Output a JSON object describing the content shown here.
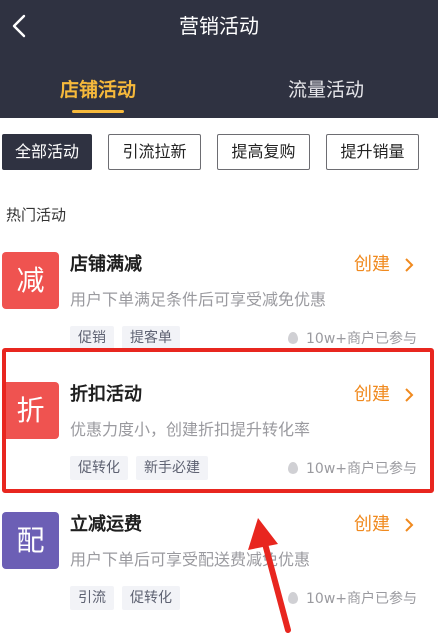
{
  "header": {
    "title": "营销活动",
    "tabs": [
      {
        "label": "店铺活动",
        "active": true
      },
      {
        "label": "流量活动",
        "active": false
      }
    ],
    "accent_color": "#f6b93b",
    "background_color": "#2f3241"
  },
  "filters": [
    {
      "label": "全部活动",
      "active": true
    },
    {
      "label": "引流拉新",
      "active": false
    },
    {
      "label": "提高复购",
      "active": false
    },
    {
      "label": "提升销量",
      "active": false
    }
  ],
  "section_title": "热门活动",
  "activities": [
    {
      "icon_char": "减",
      "icon_color": "#ef5350",
      "name": "店铺满减",
      "create_label": "创建",
      "description": "用户下单满足条件后可享受减免优惠",
      "tags": [
        "促销",
        "提客单"
      ],
      "participants": "10w+商户已参与"
    },
    {
      "icon_char": "折",
      "icon_color": "#ef5350",
      "name": "折扣活动",
      "create_label": "创建",
      "description": "优惠力度小，创建折扣提升转化率",
      "tags": [
        "促转化",
        "新手必建"
      ],
      "participants": "10w+商户已参与"
    },
    {
      "icon_char": "配",
      "icon_color": "#6c5fb5",
      "name": "立减运费",
      "create_label": "创建",
      "description": "用户下单后可享受配送费减免优惠",
      "tags": [
        "引流",
        "促转化"
      ],
      "participants": "10w+商户已参与"
    }
  ],
  "annotation_color": "#e8261f"
}
